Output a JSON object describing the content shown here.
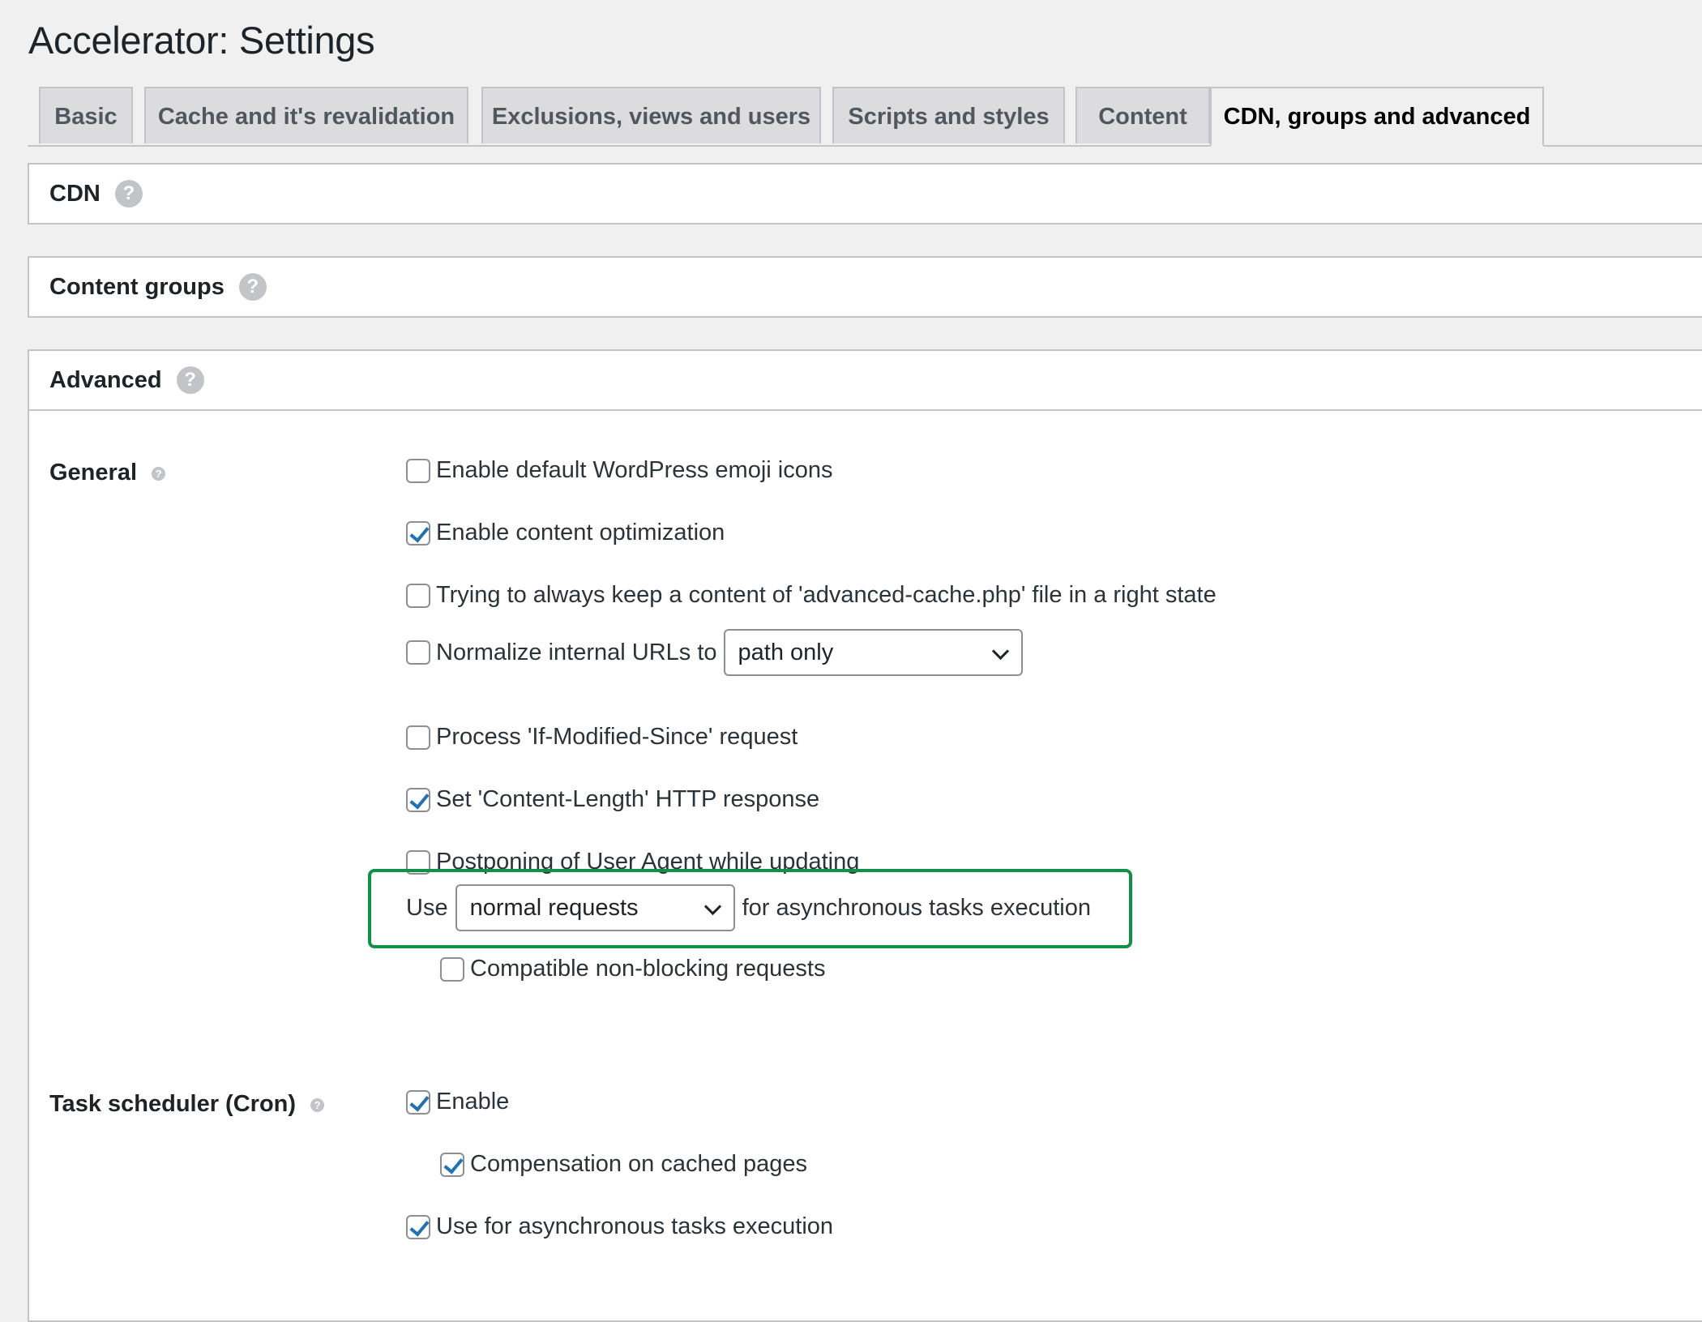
{
  "page": {
    "title": "Accelerator: Settings"
  },
  "tabs": [
    {
      "label": "Basic",
      "active": false
    },
    {
      "label": "Cache and it's revalidation",
      "active": false
    },
    {
      "label": "Exclusions, views and users",
      "active": false
    },
    {
      "label": "Scripts and styles",
      "active": false
    },
    {
      "label": "Content",
      "active": false
    },
    {
      "label": "CDN, groups and advanced",
      "active": true
    }
  ],
  "sections": {
    "cdn": {
      "title": "CDN",
      "help": "?"
    },
    "content_groups": {
      "title": "Content groups",
      "help": "?"
    },
    "advanced": {
      "title": "Advanced",
      "help": "?"
    }
  },
  "general": {
    "label": "General",
    "help": "?",
    "options": [
      {
        "label": "Enable default WordPress emoji icons",
        "checked": false
      },
      {
        "label": "Enable content optimization",
        "checked": true
      },
      {
        "label": "Trying to always keep a content of 'advanced-cache.php' file in a right state",
        "checked": false
      },
      {
        "label": "Normalize internal URLs to",
        "checked": false,
        "select_value": "path only"
      },
      {
        "label": "Process 'If-Modified-Since' request",
        "checked": false
      },
      {
        "label": "Set 'Content-Length' HTTP response",
        "checked": true
      },
      {
        "label": "Postponing of User Agent while updating",
        "checked": false
      }
    ],
    "async": {
      "prefix": "Use",
      "select_value": "normal requests",
      "suffix": "for asynchronous tasks execution",
      "highlight_color": "#119148"
    },
    "compatible": {
      "label": "Compatible non-blocking requests",
      "checked": false
    }
  },
  "cron": {
    "label": "Task scheduler (Cron)",
    "help": "?",
    "options": [
      {
        "label": "Enable",
        "checked": true
      },
      {
        "label": "Compensation on cached pages",
        "checked": true
      },
      {
        "label": "Use for asynchronous tasks execution",
        "checked": true
      }
    ]
  },
  "colors": {
    "checkbox_accent": "#2271b1",
    "background": "#f0f0f1",
    "panel": "#ffffff"
  }
}
